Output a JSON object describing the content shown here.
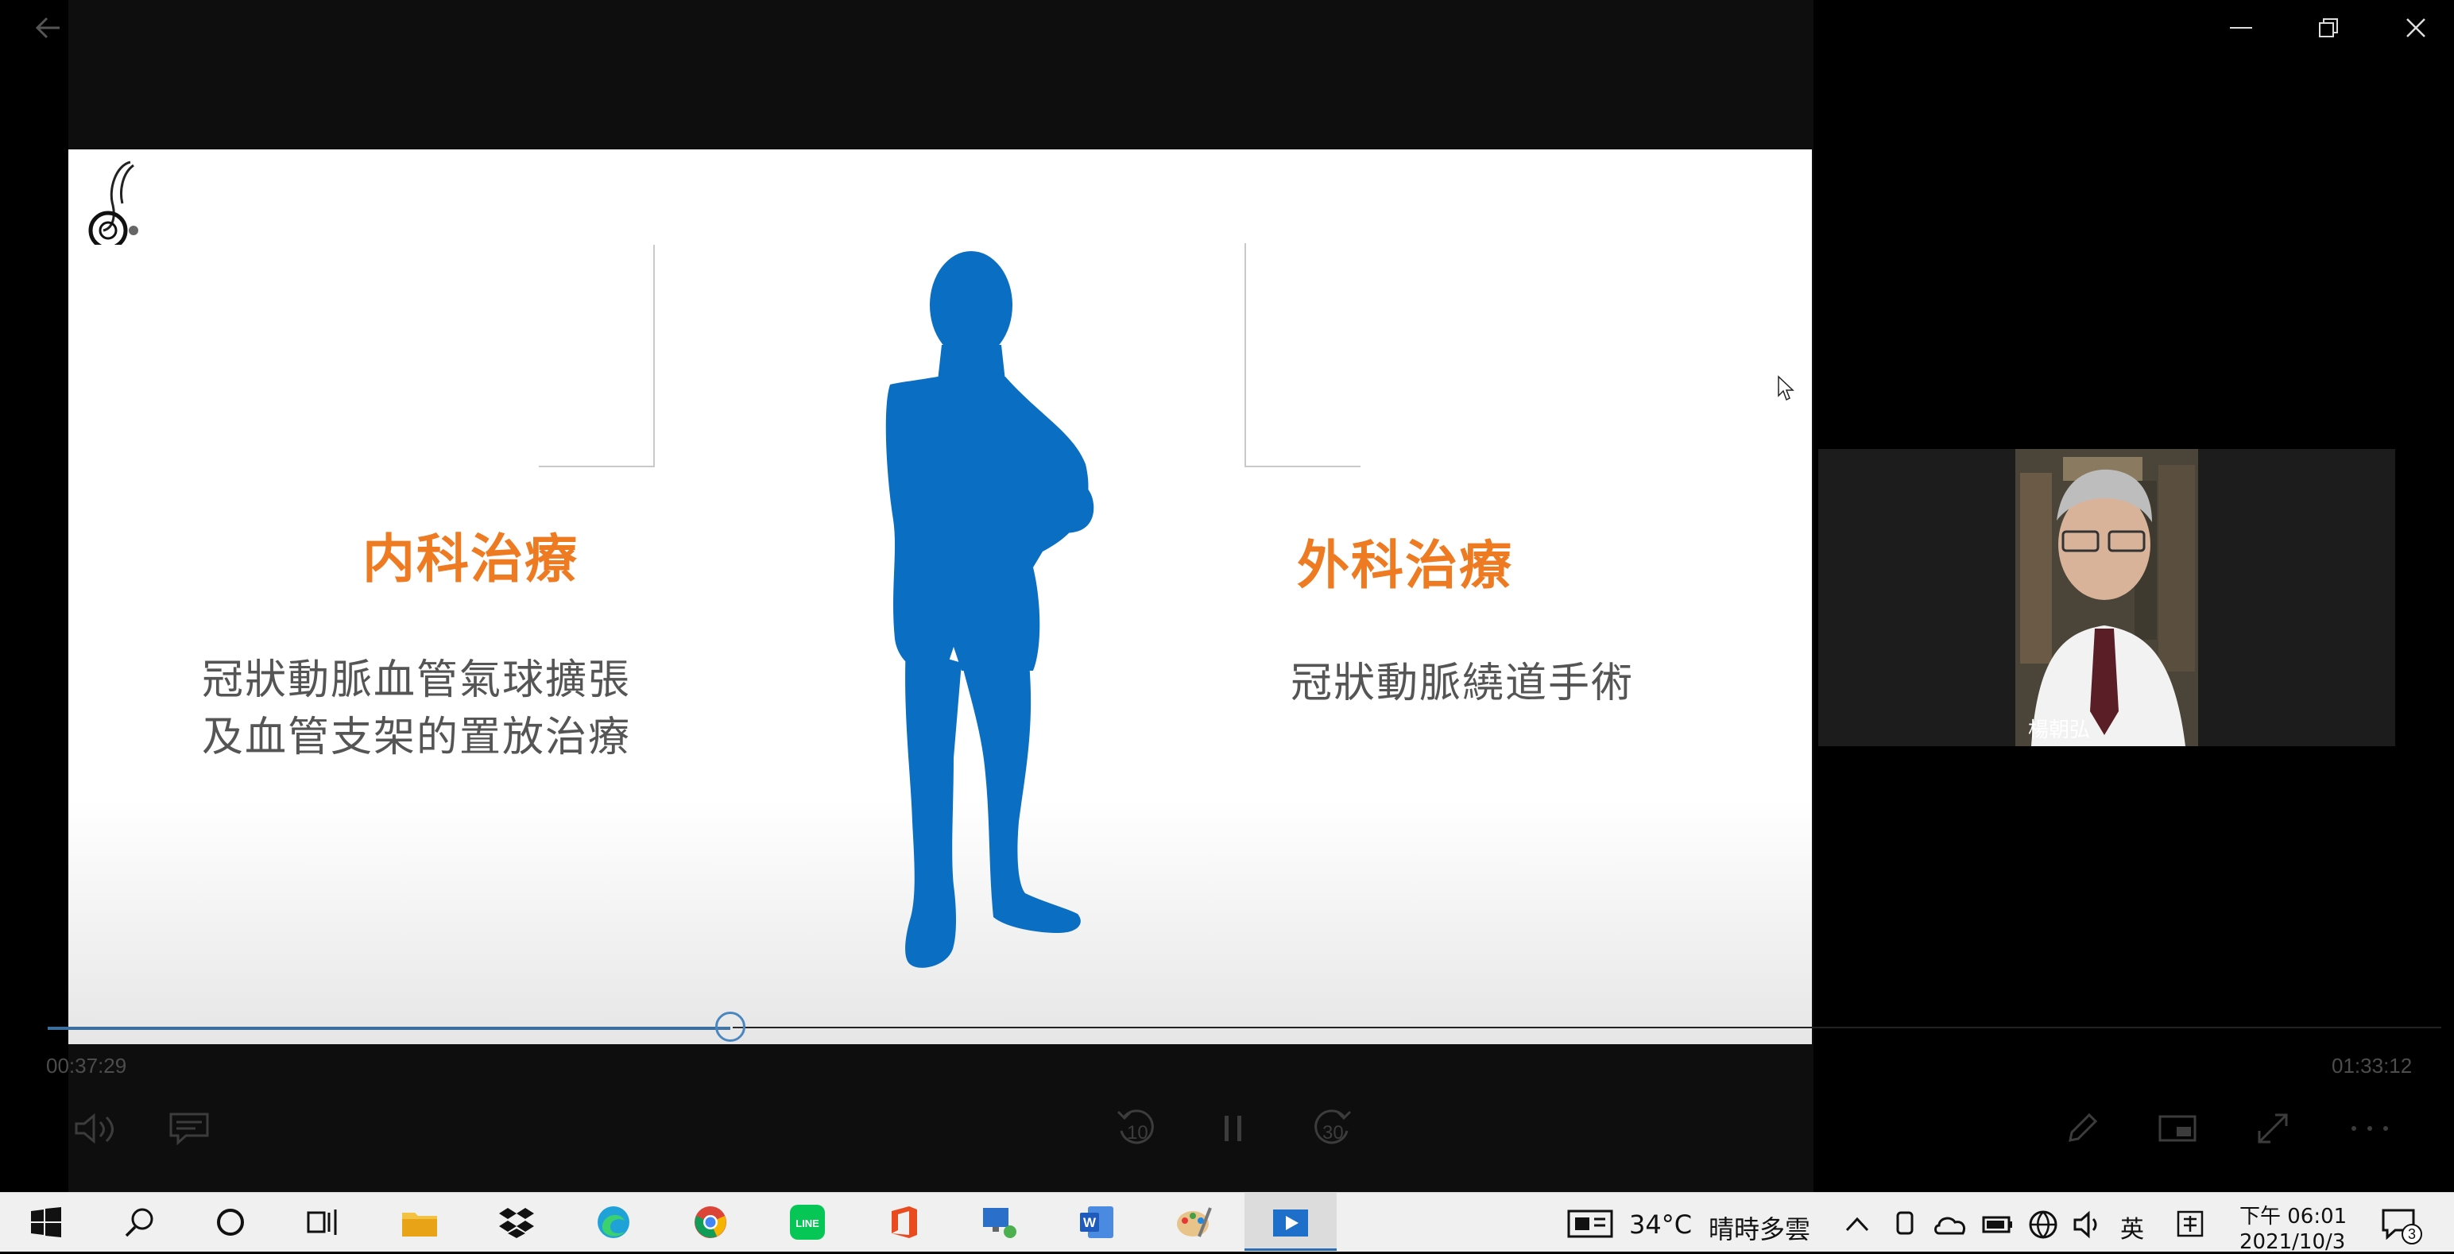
{
  "slide": {
    "left_heading": "内科治療",
    "left_body_line1": "冠狀動脈血管氣球擴張",
    "left_body_line2": "及血管支架的置放治療",
    "right_heading": "外科治療",
    "right_body": "冠狀動脈繞道手術",
    "colors": {
      "heading": "#ee7a22",
      "silhouette": "#0a6fc2"
    }
  },
  "player": {
    "elapsed": "00:37:29",
    "duration": "01:33:12",
    "progress_fraction": 0.402,
    "skip_back_seconds": "10",
    "skip_forward_seconds": "30"
  },
  "participant": {
    "name": "楊朝弘"
  },
  "taskbar": {
    "weather_temp": "34°C",
    "weather_desc": "晴時多雲",
    "input_language": "英",
    "time": "下午 06:01",
    "date": "2021/10/3",
    "notification_count": "3",
    "pinned_apps": [
      "file-explorer",
      "dropbox",
      "edge",
      "chrome",
      "line",
      "office",
      "remote-desktop",
      "word",
      "paint",
      "video-player"
    ]
  }
}
